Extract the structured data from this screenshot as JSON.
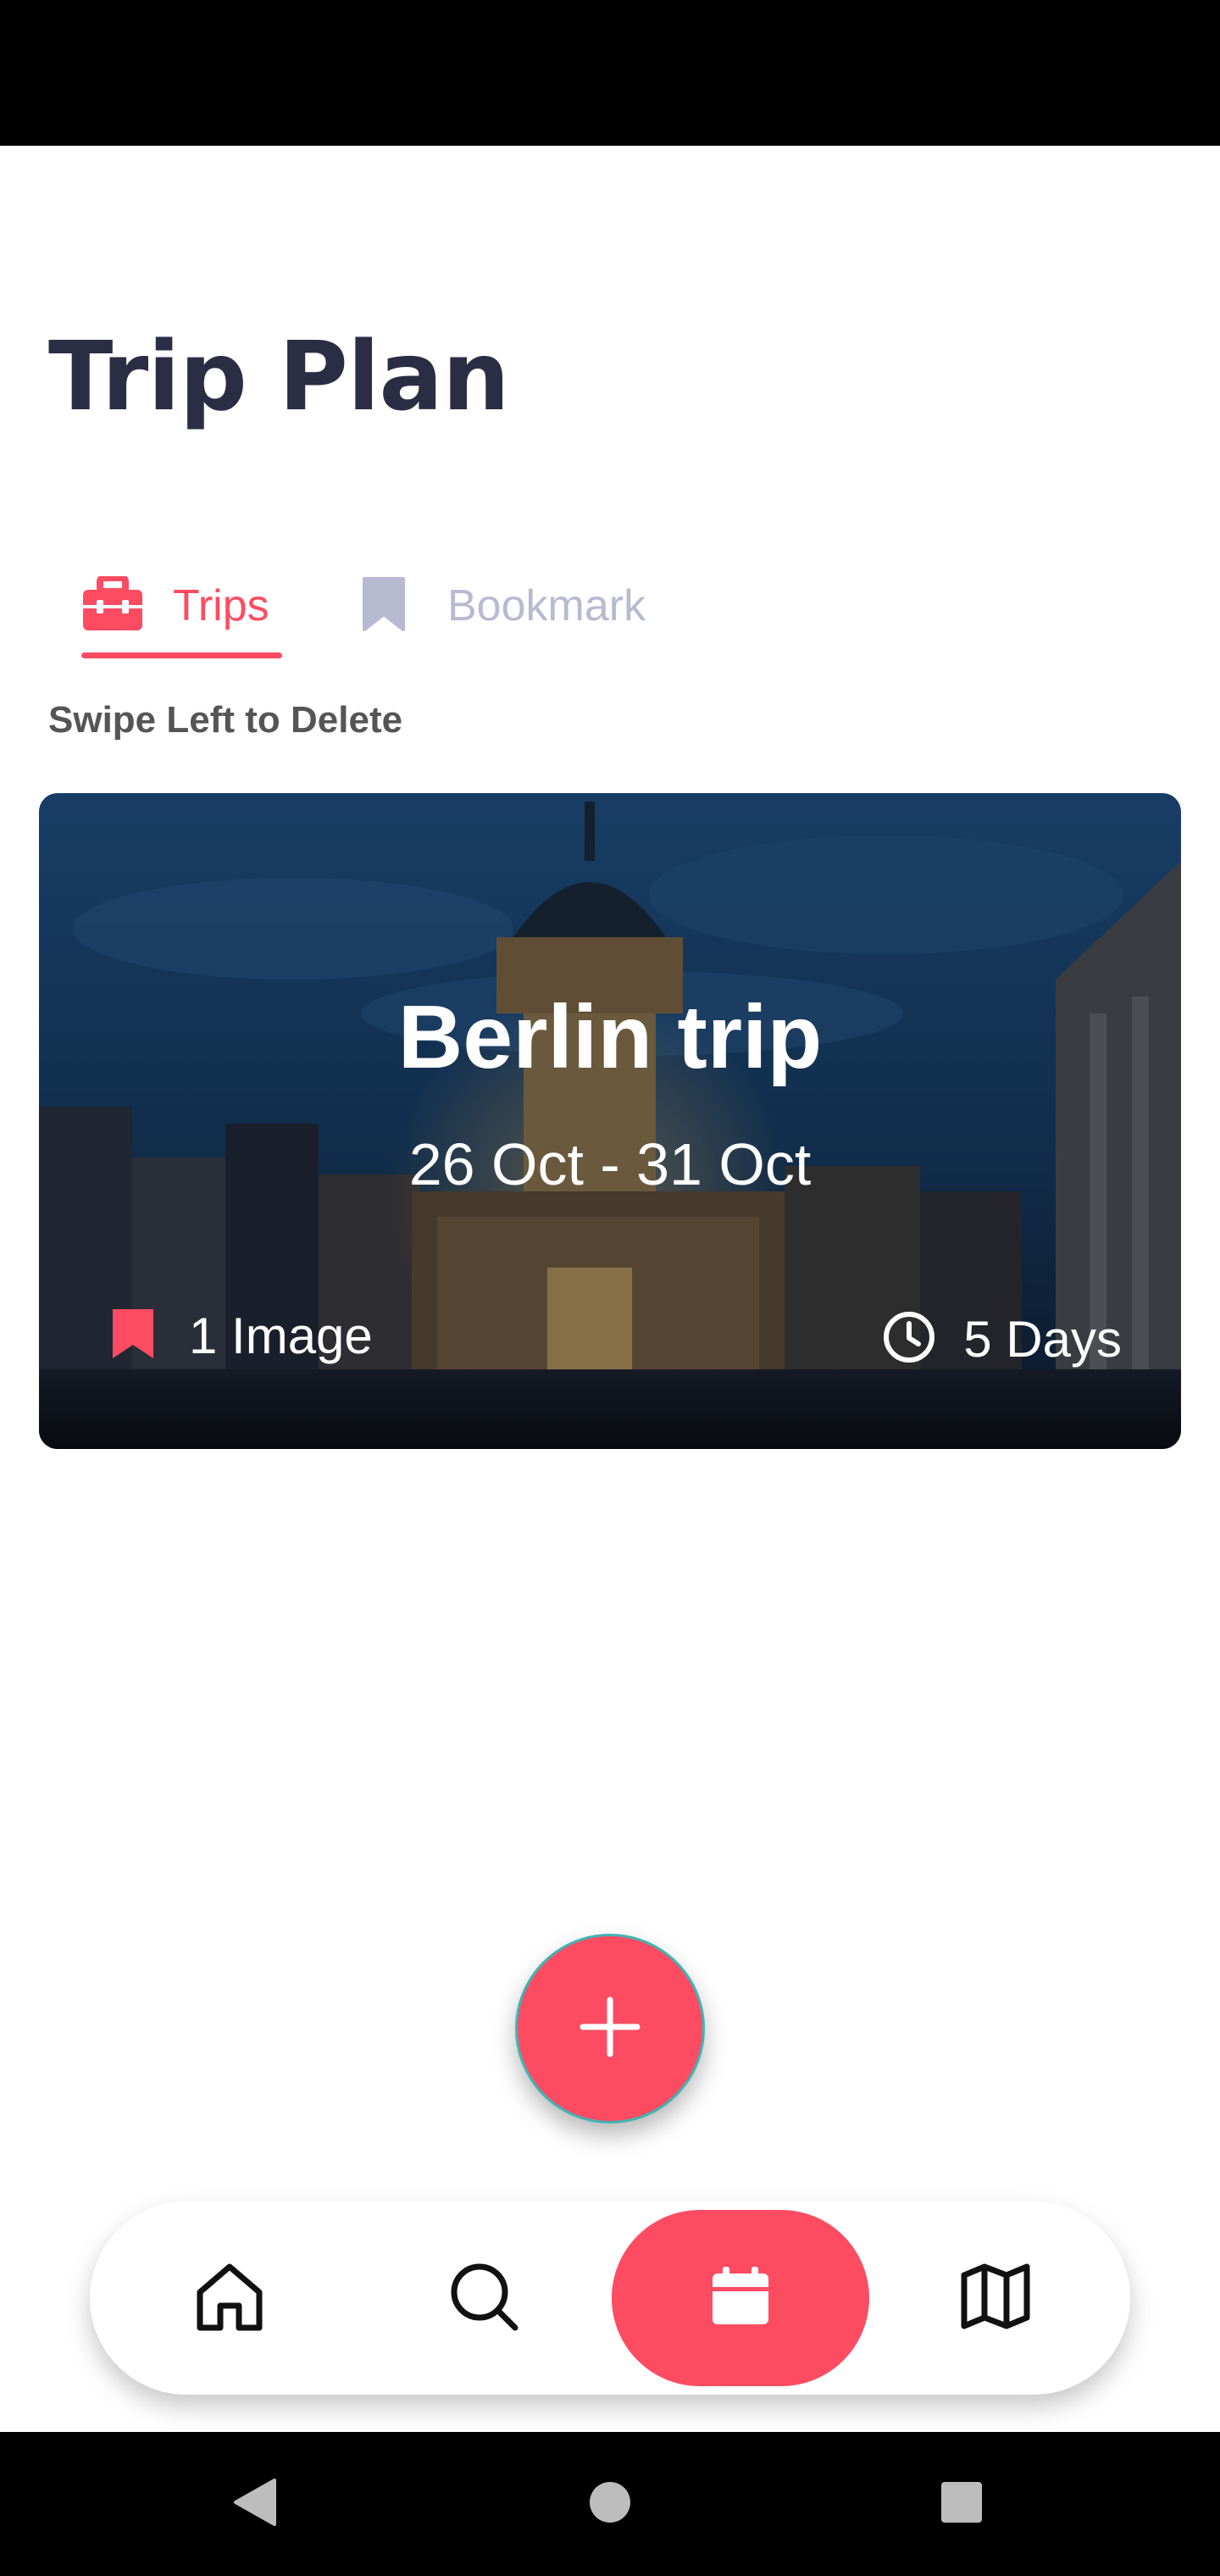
{
  "header": {
    "title": "Trip Plan"
  },
  "tabs": [
    {
      "label": "Trips",
      "icon": "briefcase-icon",
      "active": true
    },
    {
      "label": "Bookmark",
      "icon": "bookmark-icon",
      "active": false
    }
  ],
  "hint": "Swipe Left to Delete",
  "trips": [
    {
      "name": "Berlin trip",
      "dates": "26 Oct - 31 Oct",
      "images_label": "1 Image",
      "duration_label": "5 Days"
    }
  ],
  "fab": {
    "icon": "plus-icon"
  },
  "bottom_nav": [
    {
      "icon": "home-icon",
      "active": false
    },
    {
      "icon": "search-icon",
      "active": false
    },
    {
      "icon": "calendar-icon",
      "active": true
    },
    {
      "icon": "map-icon",
      "active": false
    }
  ],
  "system_nav": [
    "back-icon",
    "home-circle-icon",
    "recents-icon"
  ],
  "colors": {
    "accent": "#fd4c62",
    "title": "#2a2d43",
    "inactive_tab": "#b7bad0",
    "hint_text": "#555555"
  }
}
